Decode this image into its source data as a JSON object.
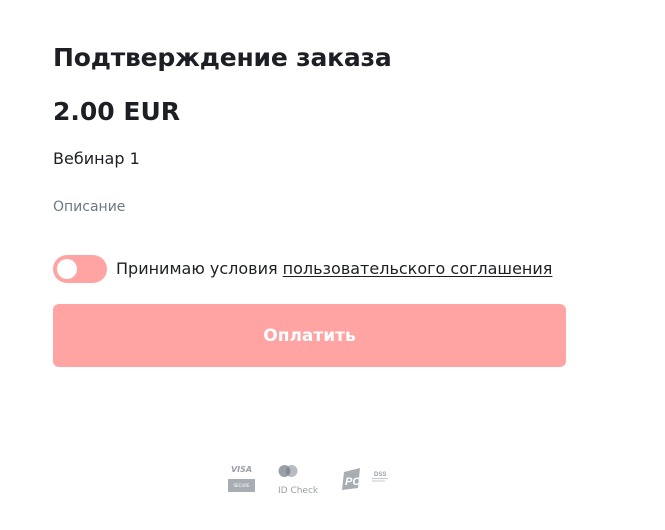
{
  "header": {
    "title": "Подтверждение заказа"
  },
  "order": {
    "price": "2.00 EUR",
    "product_name": "Вебинар 1",
    "description": "Описание"
  },
  "agreement": {
    "toggle_state": "off",
    "text": "Принимаю условия",
    "link_text": "пользовательского соглашения"
  },
  "pay_button": {
    "label": "Оплатить",
    "enabled": false
  },
  "payment_logos": {
    "visa": {
      "text": "VISA",
      "subtext": "SECURE",
      "icon": "visa-secure-logo"
    },
    "mastercard": {
      "text": "ID Check",
      "icon": "mastercard-logo"
    },
    "pci": {
      "text": "PCI",
      "subtext": "DSS",
      "icon": "pci-dss-logo"
    }
  },
  "colors": {
    "accent": "#ffa3a3",
    "text": "#1d1f24",
    "muted": "#707784",
    "logo_gray": "#9aa0a8"
  }
}
